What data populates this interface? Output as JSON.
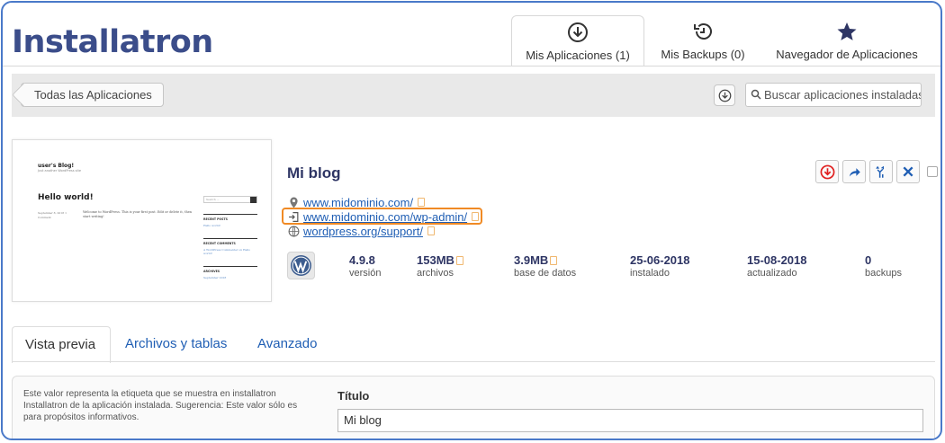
{
  "header": {
    "logo": "Installatron",
    "tabs": [
      {
        "label": "Mis Aplicaciones (1)",
        "icon": "download-circle-icon",
        "active": true
      },
      {
        "label": "Mis Backups (0)",
        "icon": "history-icon",
        "active": false
      },
      {
        "label": "Navegador de Aplicaciones",
        "icon": "star-icon",
        "active": false
      }
    ]
  },
  "toolbar": {
    "back_label": "Todas las Aplicaciones",
    "search_placeholder": "Buscar aplicaciones instaladas"
  },
  "thumbnail": {
    "site_title": "user's Blog!",
    "tagline": "Just another WordPress site",
    "post_title": "Hello world!",
    "post_meta": "September 8, 2018  1 Comment",
    "post_body": "Welcome to WordPress. This is your first post. Edit or delete it, then start writing!",
    "sidebar_search": "Search ...",
    "recent_posts": "RECENT POSTS",
    "recent_post_item": "Hello world!",
    "recent_comments": "RECENT COMMENTS",
    "recent_comment_item": "A WordPress Commenter on Hello world!",
    "archives": "ARCHIVES",
    "archive_item": "September 2018"
  },
  "app": {
    "title": "Mi blog",
    "links": [
      {
        "icon": "location-pin-icon",
        "text": "www.midominio.com/"
      },
      {
        "icon": "login-icon",
        "text": "www.midominio.com/wp-admin/"
      },
      {
        "icon": "globe-icon",
        "text": "wordpress.org/support/"
      }
    ],
    "stats": [
      {
        "value": "4.9.8",
        "label": "versión",
        "copy": false
      },
      {
        "value": "153MB",
        "label": "archivos",
        "copy": true
      },
      {
        "value": "3.9MB",
        "label": "base de datos",
        "copy": true
      },
      {
        "value": "25-06-2018",
        "label": "instalado",
        "copy": false
      },
      {
        "value": "15-08-2018",
        "label": "actualizado",
        "copy": false
      },
      {
        "value": "0",
        "label": "backups",
        "copy": false
      }
    ]
  },
  "bottom_tabs": [
    {
      "label": "Vista previa",
      "active": true
    },
    {
      "label": "Archivos y tablas",
      "active": false
    },
    {
      "label": "Avanzado",
      "active": false
    }
  ],
  "form": {
    "description": "Este valor representa la etiqueta que se muestra en installatron Installatron de la aplicación instalada. Sugerencia: Este valor sólo es para propósitos informativos.",
    "field_label": "Título",
    "field_value": "Mi blog"
  },
  "colors": {
    "frame": "#4a79c9",
    "logo": "#3b4d8a",
    "link": "#1f5eb4",
    "highlight": "#f08a24",
    "backup_icon": "#e02020"
  }
}
